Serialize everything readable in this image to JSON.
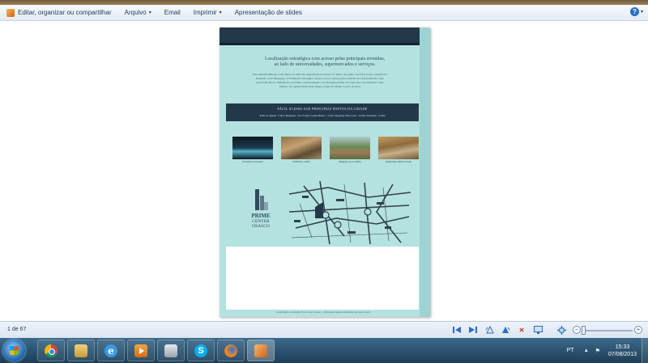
{
  "toolbar": {
    "share_label": "Editar, organizar ou compartilhar",
    "arquivo_label": "Arquivo",
    "email_label": "Email",
    "imprimir_label": "Imprimir",
    "slides_label": "Apresentação de slides",
    "help_icon": "help-icon",
    "caret": "▾"
  },
  "document": {
    "heading_line1": "Localização estratégica com acesso pelas principais avenidas,",
    "heading_line2": "ao lado de universidades, supermercados e serviços.",
    "body_line1": "Este empreendimento é um marco no mercado empresarial de Osasco. É dentro da região com fácil acesso comercial é",
    "body_line2": "integrado a um Shopping. A localização estratégica oferece acesso rápido pelas avenidas dos Autonomistas como",
    "body_line3": "pela Ponte Nova. Também fica próximo a universidades e do Shopping União. Por tudo isso, seu empresa e seus",
    "body_line4": "clientes vão ganhar muito mais tempo, longe do trânsito e perto de tudo.",
    "access_title": "FÁCIL ACESSO AOS PRINCIPAIS PONTOS DA CIDADE",
    "access_sub": "Ponte do Jaguaré - 5 min | Marginais - 10 a 15 min | Castelo Branco - 5 min | Shopping Villa-Lobos - 10 min | Rodoanel - 15 min",
    "photo_captions": [
      "PONTE DO JAGUARÉ",
      "SHOPPING UNIÃO",
      "PARQUE VILLA-LOBOS",
      "RODOANEL MÁRIO COVAS"
    ],
    "logo_line1": "PRIME",
    "logo_line2": "CENTER",
    "logo_line3": "OSASCO",
    "footer": "Incorporação e construção: Prime Center Osasco — informações sujeitas a alterações sem aviso prévio."
  },
  "status": {
    "page_info": "1 de 67"
  },
  "taskbar": {
    "language": "PT",
    "time": "15:33",
    "date": "07/08/2013"
  },
  "colors": {
    "doc_background": "#b4e2e0",
    "doc_dark": "#24384b",
    "accent": "#2b6cc4"
  }
}
